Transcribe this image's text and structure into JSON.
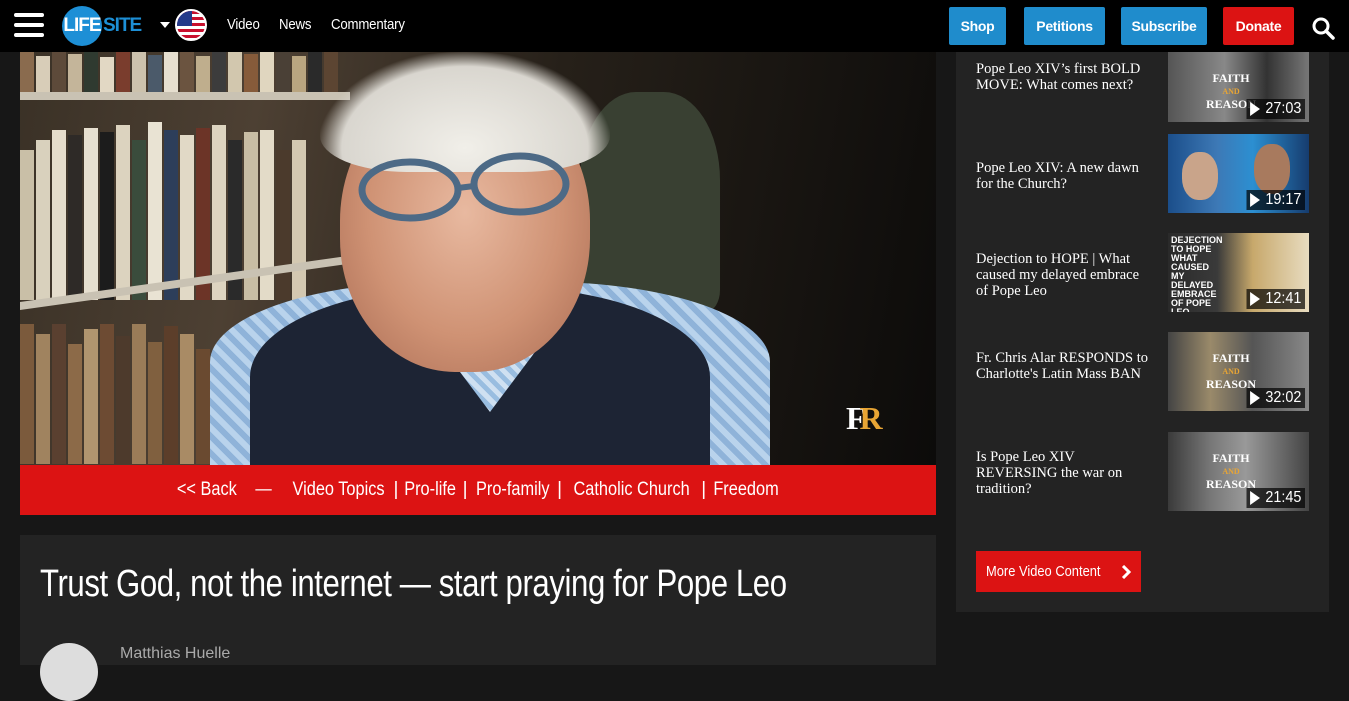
{
  "header": {
    "logo_main": "LIFE",
    "logo_sub": "SITE",
    "nav": [
      "Video",
      "News",
      "Commentary"
    ],
    "buttons": {
      "shop": "Shop",
      "petitions": "Petitions",
      "subscribe": "Subscribe",
      "donate": "Donate"
    }
  },
  "video": {
    "watermark_f": "F",
    "watermark_r": "R"
  },
  "topics": {
    "back": "<< Back",
    "dash": "—",
    "items": [
      "Video Topics",
      "Pro-life",
      "Pro-family",
      "Catholic Church",
      "Freedom"
    ],
    "separator": "|"
  },
  "article": {
    "title": "Trust God, not the internet — start praying for Pope Leo",
    "author": "Matthias Huelle"
  },
  "sidebar": {
    "videos": [
      {
        "title": "Pope Leo XIV’s first BOLD MOVE: What comes next?",
        "duration": "27:03",
        "thumb": "faith-and-reason"
      },
      {
        "title": "Pope Leo XIV: A new dawn for the Church?",
        "duration": "19:17",
        "thumb": "two-hosts"
      },
      {
        "title": "Dejection to HOPE | What caused my delayed embrace of Pope Leo",
        "duration": "12:41",
        "thumb": "dejection-to-hope"
      },
      {
        "title": "Fr. Chris Alar RESPONDS to Charlotte's Latin Mass BAN",
        "duration": "32:02",
        "thumb": "faith-and-reason"
      },
      {
        "title": "Is Pope Leo XIV REVERSING the war on tradition?",
        "duration": "21:45",
        "thumb": "faith-and-reason"
      }
    ],
    "thumb_faith": "FAITH",
    "thumb_and": "AND",
    "thumb_reason": "REASON",
    "thumb_dejection": "DEJECTION TO HOPE WHAT CAUSED MY DELAYED EMBRACE OF POPE LEO",
    "more_button": "More Video Content"
  },
  "colors": {
    "brand_blue": "#1f8ccc",
    "brand_red": "#dc1313",
    "accent_gold": "#e8a534"
  }
}
